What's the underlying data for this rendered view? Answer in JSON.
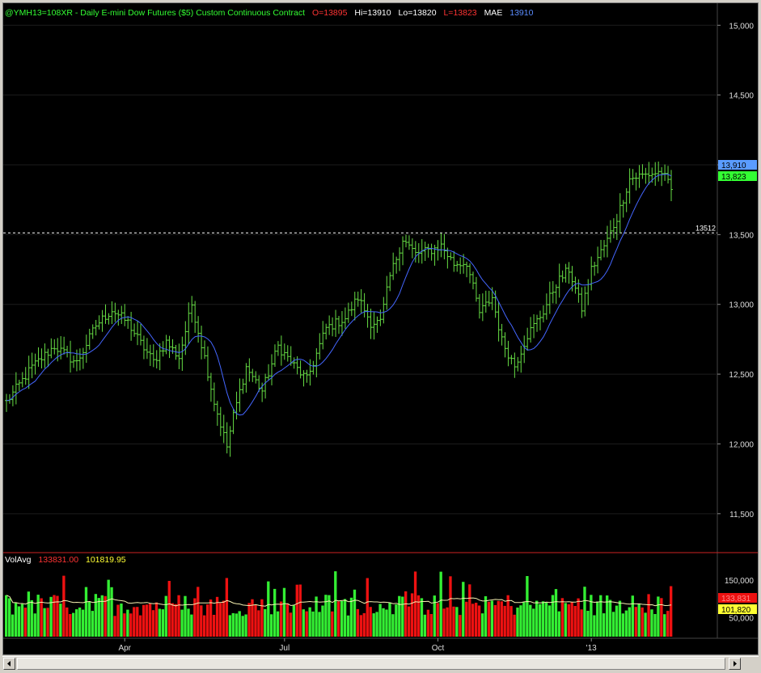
{
  "header": {
    "symbol": "@YMH13=108XR - Daily  E-mini Dow Futures ($5) Custom Continuous Contract",
    "open": "O=13895",
    "high": "Hi=13910",
    "low": "Lo=13820",
    "last": "L=13823",
    "mae_label": "MAE",
    "mae_value": "13910"
  },
  "volume_header": {
    "label": "VolAvg",
    "value1": "133831.00",
    "value2": "101819.95"
  },
  "axis_badges": {
    "mae": "13,910",
    "last": "13,823",
    "vol_last": "133,831",
    "vol_avg": "101,820"
  },
  "reference_line": {
    "label": "13512",
    "value": 13512
  },
  "colors": {
    "background": "#000000",
    "up": "#66dd44",
    "mae": "#4466ff",
    "vol_up": "#33ee33",
    "vol_down": "#ee1111",
    "vol_avg": "#f5f0b0",
    "header_text": "#33ff33",
    "open_text": "#ff3333",
    "hilo_text": "#ffffff",
    "last_text": "#ff3333",
    "mae_text": "#5a8cff"
  },
  "chart_data": [
    {
      "type": "ohlc",
      "ylim": [
        11250,
        15100
      ],
      "yticks": [
        {
          "v": 11500,
          "label": "11,500"
        },
        {
          "v": 12000,
          "label": "12,000"
        },
        {
          "v": 12500,
          "label": "12,500"
        },
        {
          "v": 13000,
          "label": "13,000"
        },
        {
          "v": 13500,
          "label": "13,500"
        },
        {
          "v": 14000,
          "label": "14,000"
        },
        {
          "v": 14500,
          "label": "14,500"
        },
        {
          "v": 15000,
          "label": "15,000"
        }
      ],
      "xticks": [
        {
          "index": 37,
          "label": "Apr"
        },
        {
          "index": 87,
          "label": "Jul"
        },
        {
          "index": 135,
          "label": "Oct"
        },
        {
          "index": 183,
          "label": "'13"
        }
      ],
      "n_bars": 209,
      "anchors": [
        [
          0,
          12300
        ],
        [
          8,
          12550
        ],
        [
          15,
          12700
        ],
        [
          22,
          12580
        ],
        [
          28,
          12850
        ],
        [
          33,
          12960
        ],
        [
          38,
          12870
        ],
        [
          42,
          12720
        ],
        [
          46,
          12590
        ],
        [
          50,
          12730
        ],
        [
          54,
          12620
        ],
        [
          58,
          13000
        ],
        [
          62,
          12620
        ],
        [
          65,
          12300
        ],
        [
          69,
          11980
        ],
        [
          71,
          12200
        ],
        [
          75,
          12550
        ],
        [
          80,
          12380
        ],
        [
          85,
          12700
        ],
        [
          90,
          12560
        ],
        [
          94,
          12460
        ],
        [
          100,
          12830
        ],
        [
          106,
          12900
        ],
        [
          110,
          13050
        ],
        [
          114,
          12870
        ],
        [
          117,
          12870
        ],
        [
          120,
          13200
        ],
        [
          124,
          13470
        ],
        [
          128,
          13360
        ],
        [
          133,
          13390
        ],
        [
          136,
          13420
        ],
        [
          140,
          13290
        ],
        [
          144,
          13300
        ],
        [
          148,
          12940
        ],
        [
          152,
          13050
        ],
        [
          155,
          12740
        ],
        [
          159,
          12560
        ],
        [
          163,
          12780
        ],
        [
          168,
          12950
        ],
        [
          172,
          13150
        ],
        [
          176,
          13250
        ],
        [
          180,
          12970
        ],
        [
          183,
          13250
        ],
        [
          188,
          13460
        ],
        [
          191,
          13620
        ],
        [
          195,
          13900
        ],
        [
          198,
          13920
        ],
        [
          205,
          13950
        ],
        [
          208,
          13823
        ]
      ],
      "mae_period": 10
    },
    {
      "type": "bar",
      "series": "volume",
      "ylim": [
        0,
        180000
      ],
      "yticks": [
        {
          "v": 50000,
          "label": "50,000"
        },
        {
          "v": 150000,
          "label": "150,000"
        }
      ],
      "avg_period": 20
    }
  ]
}
